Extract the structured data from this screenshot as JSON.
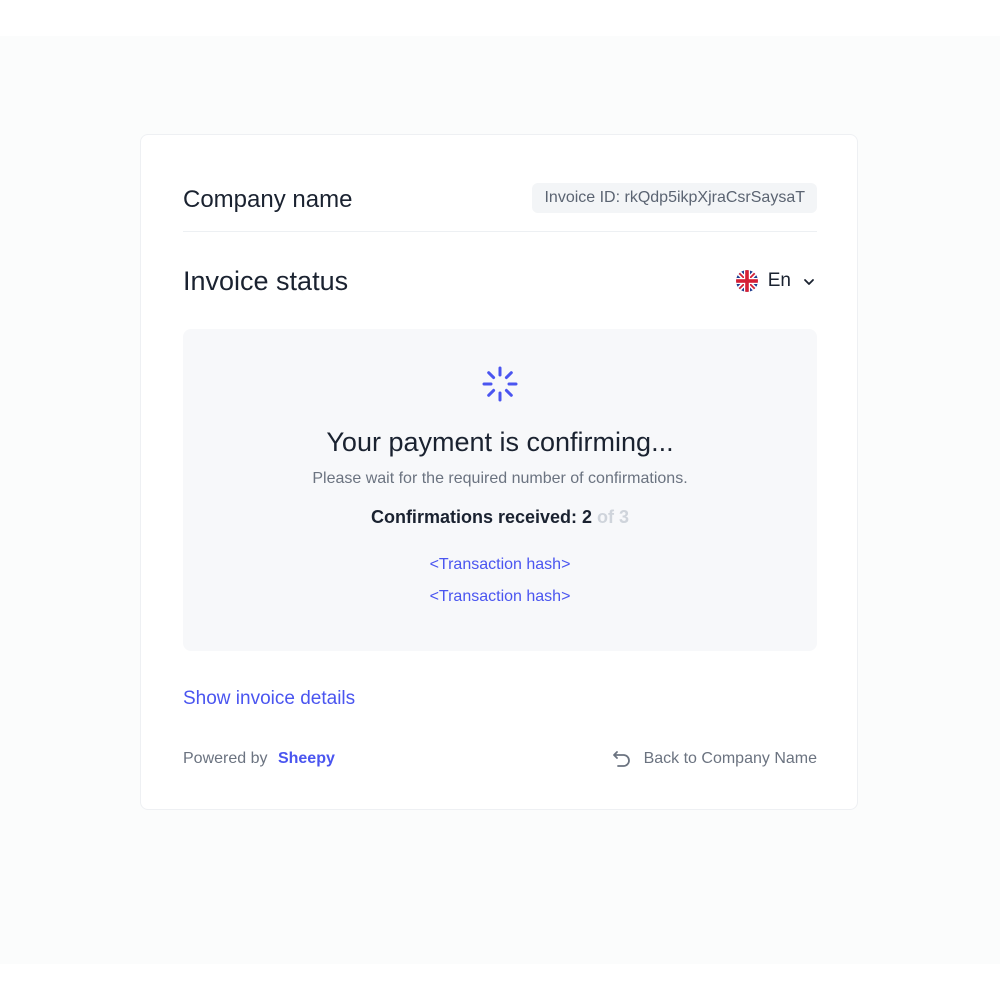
{
  "header": {
    "company_name": "Company name",
    "invoice_id": "Invoice ID: rkQdp5ikpXjraCsrSaysaT"
  },
  "status": {
    "title": "Invoice status",
    "language": "En",
    "language_icon": "uk-flag-icon"
  },
  "panel": {
    "icon": "spinner-icon",
    "title": "Your payment is confirming...",
    "subtitle": "Please wait for the required number of confirmations.",
    "confirmations_label": "Confirmations received: 2",
    "confirmations_total": "of 3",
    "confirmations_received": 2,
    "confirmations_required": 3,
    "transactions": [
      "<Transaction hash>",
      "<Transaction hash>"
    ]
  },
  "details_link": "Show invoice details",
  "footer": {
    "powered_by": "Powered by",
    "brand": "Sheepy",
    "back_label": "Back to Company Name",
    "back_icon": "undo-arrow-icon"
  },
  "colors": {
    "accent": "#4a55f0",
    "text": "#1a2230",
    "muted": "#6b7380",
    "panel_bg": "#f7f8fa"
  }
}
